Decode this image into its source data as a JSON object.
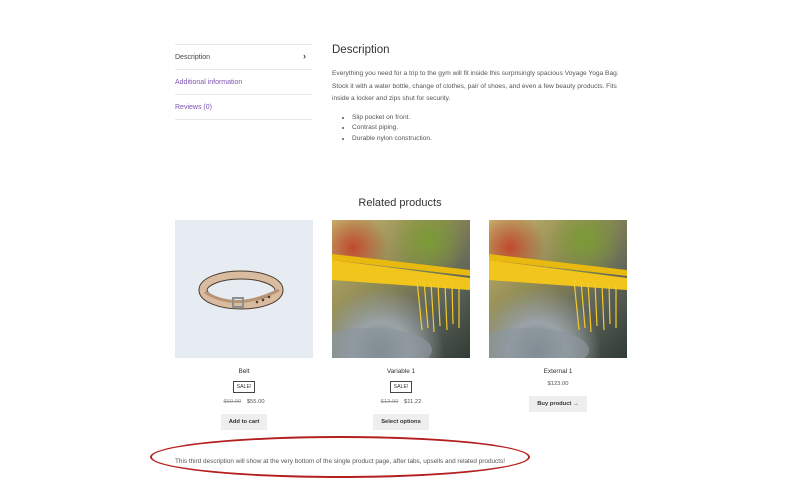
{
  "tabs": [
    {
      "label": "Description",
      "active": true
    },
    {
      "label": "Additional information",
      "active": false
    },
    {
      "label": "Reviews (0)",
      "active": false
    }
  ],
  "description": {
    "heading": "Description",
    "paragraph": "Everything you need for a trip to the gym will fit inside this surprisingly spacious Voyage Yoga Bag. Stock it with a water bottle, change of clothes, pair of shoes, and even a few beauty products. Fits inside a locker and zips shut for security.",
    "bullets": [
      "Slip pocket on front.",
      "Contrast piping.",
      "Durable nylon construction."
    ]
  },
  "related": {
    "title": "Related products",
    "products": [
      {
        "name": "Belt",
        "badge": "SALE!",
        "old_price": "$60.00",
        "price": "$55.00",
        "button": "Add to cart"
      },
      {
        "name": "Variable 1",
        "badge": "SALE!",
        "old_price": "$12.00",
        "price": "$11.22",
        "button": "Select options"
      },
      {
        "name": "External 1",
        "price": "$123.00",
        "button": "Buy product →"
      }
    ]
  },
  "note": "This third description will show at the very bottom of the single product page, after tabs, upsells and related products!",
  "colors": {
    "link": "#7f54b3",
    "annotation": "#b41f1f",
    "button_bg": "#eeeeee"
  }
}
